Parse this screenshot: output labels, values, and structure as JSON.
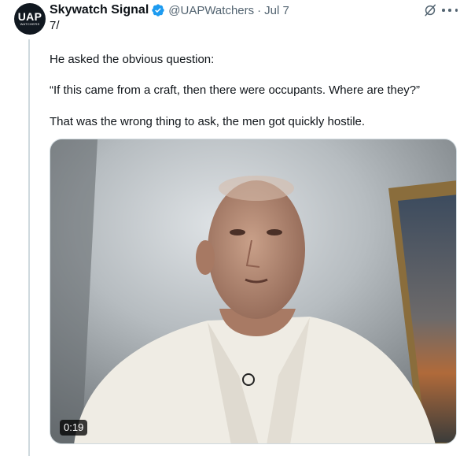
{
  "avatar": {
    "text": "UAP",
    "subtext": "WATCHERS"
  },
  "author": {
    "display_name": "Skywatch Signal",
    "handle": "@UAPWatchers",
    "separator": "·",
    "date": "Jul 7",
    "verified_icon": "verified-badge-icon",
    "verified_color": "#1d9bf0"
  },
  "post": {
    "thread_index": "7/",
    "lines": [
      "He asked the obvious question:",
      "“If this came from a craft, then there were occupants. Where are they?”",
      "That was the wrong thing to ask, the men got quickly hostile."
    ]
  },
  "media": {
    "type": "video",
    "duration": "0:19"
  },
  "icons": {
    "grok": "grok-icon",
    "more": "more-options-icon"
  }
}
